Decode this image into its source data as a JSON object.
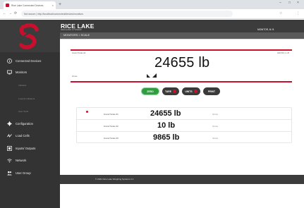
{
  "browser": {
    "tab_title": "Rice Lake Connected Devices",
    "tab_close": "×",
    "new_tab": "+",
    "url": "Not secure | http://localhost/connected/devices/monitors",
    "window_controls": [
      "–",
      "□",
      "×"
    ],
    "nav": [
      "←",
      "→",
      "⟳"
    ],
    "ext_icons": [
      "☆",
      "⋮"
    ]
  },
  "header": {
    "brand": "RICE LAKE",
    "brand_sub": "WEIGHING SYSTEMS",
    "user": "MONITOR, M. B"
  },
  "subbar": {
    "title": "MONITORS > SCALE"
  },
  "sidebar": {
    "items": [
      {
        "label": "Connected Devices",
        "icon": "info-icon"
      },
      {
        "label": "Monitors",
        "icon": "monitor-icon"
      },
      {
        "label": "Configuration",
        "icon": "gear-icon"
      },
      {
        "label": "Load Cells",
        "icon": "load-cell-icon"
      },
      {
        "label": "Inputs/ Outputs",
        "icon": "io-icon"
      },
      {
        "label": "Network",
        "icon": "wifi-icon"
      },
      {
        "label": "User Group",
        "icon": "users-icon"
      }
    ],
    "subitems": [
      "Indicator",
      "Load & Indicators",
      "User Tools"
    ]
  },
  "scale": {
    "label_left": "Grand Scale #1",
    "label_right": "GROSS 1 LB",
    "gross": "Gross",
    "weight": "24655 lb"
  },
  "buttons": {
    "zero": "ZERO",
    "tare": "TARE",
    "units": "UNITS",
    "print": "PRINT"
  },
  "table": {
    "rows": [
      {
        "name": "Grand Scale #1",
        "weight": "24655 lb",
        "status": "Gross"
      },
      {
        "name": "Grand Scale #2",
        "weight": "10 lb",
        "status": "Gross"
      },
      {
        "name": "Grand Scale #3",
        "weight": "9865 lb",
        "status": "Gross"
      }
    ]
  },
  "footer": {
    "text": "© 2021 Rice Lake Weighing Systems 2.1"
  },
  "colors": {
    "brand_red": "#c8102e",
    "header_dark": "#3c3c3c",
    "sidebar": "#333333",
    "zero_green": "#2e9e3e",
    "dark_button": "#3a3a3a"
  }
}
